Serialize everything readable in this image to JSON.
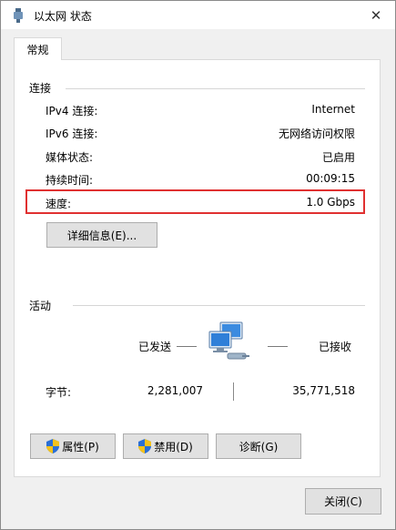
{
  "window": {
    "title": "以太网 状态",
    "close_glyph": "✕"
  },
  "tab": {
    "label": "常规"
  },
  "connection": {
    "heading": "连接",
    "rows": [
      {
        "label": "IPv4 连接:",
        "value": "Internet"
      },
      {
        "label": "IPv6 连接:",
        "value": "无网络访问权限"
      },
      {
        "label": "媒体状态:",
        "value": "已启用"
      },
      {
        "label": "持续时间:",
        "value": "00:09:15"
      },
      {
        "label": "速度:",
        "value": "1.0 Gbps"
      }
    ],
    "details_button": "详细信息(E)..."
  },
  "activity": {
    "heading": "活动",
    "sent_label": "已发送",
    "received_label": "已接收",
    "bytes_label": "字节:",
    "bytes_sent": "2,281,007",
    "bytes_received": "35,771,518"
  },
  "buttons": {
    "properties": "属性(P)",
    "disable": "禁用(D)",
    "diagnose": "诊断(G)",
    "close": "关闭(C)"
  },
  "colors": {
    "highlight_border": "#e03030",
    "shield_blue": "#2a6fd6",
    "shield_yellow": "#f4c21b"
  },
  "icons": [
    "ethernet-icon",
    "network-computers-icon",
    "shield-icon",
    "close-icon"
  ]
}
